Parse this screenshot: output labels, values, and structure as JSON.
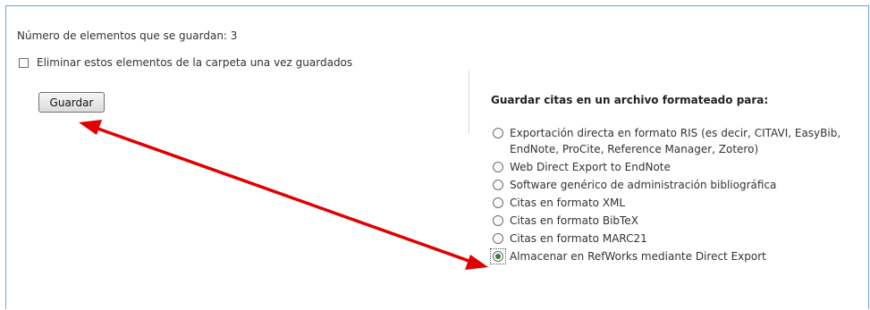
{
  "items_count_text": "Número de elementos que se guardan: 3",
  "remove_checkbox": {
    "label": "Eliminar estos elementos de la carpeta una vez guardados",
    "checked": false
  },
  "save_button": {
    "label": "Guardar"
  },
  "format_panel": {
    "heading": "Guardar citas en un archivo formateado para:",
    "options": [
      {
        "label": "Exportación directa en formato RIS (es decir, CITAVI, EasyBib, EndNote, ProCite, Reference Manager, Zotero)",
        "selected": false
      },
      {
        "label": "Web Direct Export to EndNote",
        "selected": false
      },
      {
        "label": "Software genérico de administración bibliográfica",
        "selected": false
      },
      {
        "label": "Citas en formato XML",
        "selected": false
      },
      {
        "label": "Citas en formato BibTeX",
        "selected": false
      },
      {
        "label": "Citas en formato MARC21",
        "selected": false
      },
      {
        "label": "Almacenar en RefWorks mediante Direct Export",
        "selected": true
      }
    ]
  },
  "colors": {
    "frame_border": "#6fa6d6",
    "annotation_arrow": "#e00000"
  }
}
